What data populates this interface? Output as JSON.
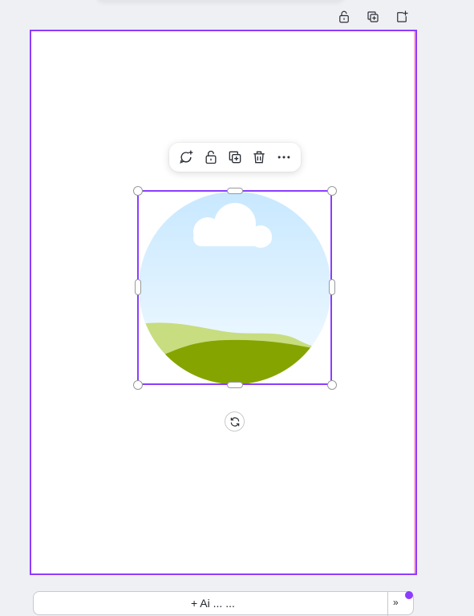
{
  "page_actions": {
    "icons": [
      "unlock-icon",
      "duplicate-page-icon",
      "add-page-icon"
    ]
  },
  "element_toolbar": {
    "icons": [
      "add-comment-icon",
      "unlock-icon",
      "duplicate-icon",
      "delete-icon",
      "more-icon"
    ]
  },
  "selected_element": {
    "kind": "circle-image",
    "description": "sky-cloud-hills-placeholder"
  },
  "bottom_bar": {
    "label": "+ Ai ... ..."
  },
  "colors": {
    "accent": "#8b3dff",
    "canvas_bg": "#eef0f4",
    "page_bg": "#ffffff",
    "sky_top": "#c8e8ff",
    "sky_bottom": "#eaf6ff",
    "hill_light": "#c7dd80",
    "hill_dark": "#86a400"
  }
}
